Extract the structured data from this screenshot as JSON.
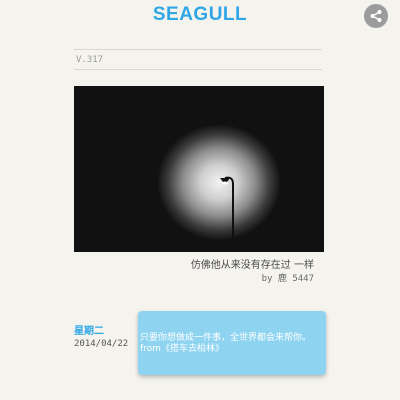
{
  "header": {
    "title": "SEAGULL",
    "share_icon": "share-icon",
    "title_color": "#2fa7e6"
  },
  "article": {
    "volume": "V.317",
    "image": {
      "description_icon": "cover-photo"
    },
    "quote": "仿佛他从来没有存在过 一样",
    "author": "by 鹿 5447"
  },
  "entry": {
    "weekday": "星期二",
    "date": "2014/04/22",
    "message": "只要你想做成一件事，全世界都会来帮你。from《搭车去柏林》",
    "card_color": "#8ed3f0"
  }
}
